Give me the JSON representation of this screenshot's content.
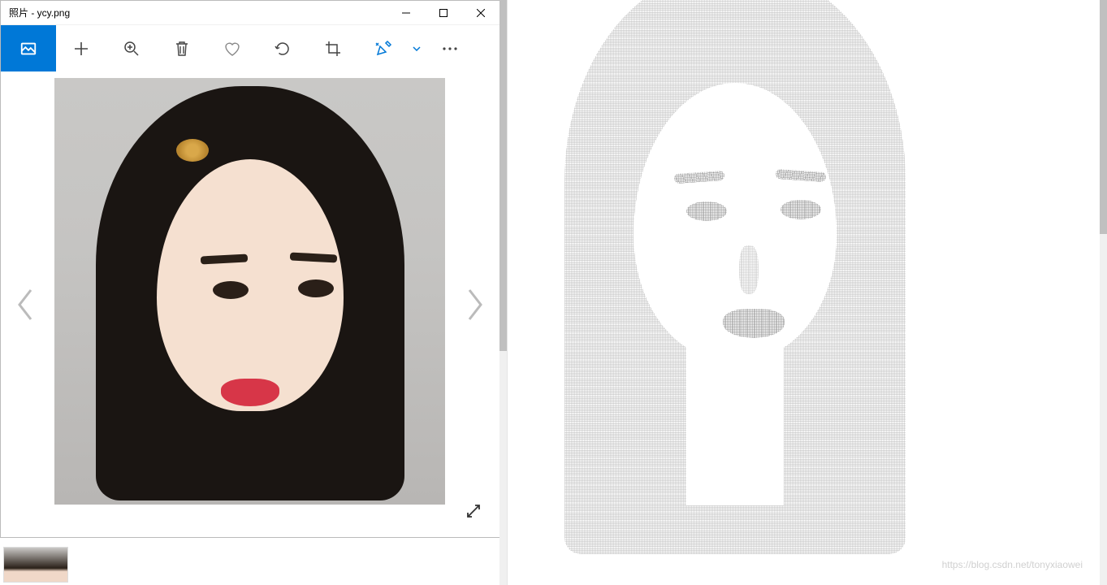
{
  "window": {
    "title": "照片 - ycy.png"
  },
  "toolbar": {
    "icons": {
      "collection": "photo-collection-icon",
      "add": "add-icon",
      "zoom": "zoom-icon",
      "delete": "delete-icon",
      "favorite": "heart-icon",
      "rotate": "rotate-icon",
      "crop": "crop-icon",
      "edit": "edit-draw-icon",
      "more": "more-icon"
    }
  },
  "watermark": "https://blog.csdn.net/tonyxiaowei",
  "colors": {
    "accent": "#0078d7",
    "titlebar_bg": "#ffffff",
    "text": "#000000"
  }
}
